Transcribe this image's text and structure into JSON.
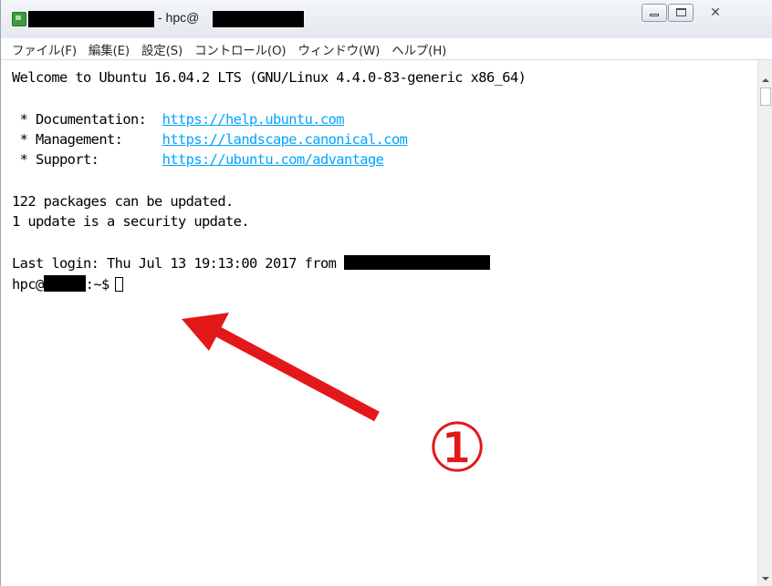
{
  "window": {
    "title_suffix": " - hpc@",
    "buttons": {
      "minimize": "minimize",
      "maximize": "maximize",
      "close": "✕"
    }
  },
  "menu": [
    "ファイル(F)",
    "編集(E)",
    "設定(S)",
    "コントロール(O)",
    "ウィンドウ(W)",
    "ヘルプ(H)"
  ],
  "terminal": {
    "welcome": "Welcome to Ubuntu 16.04.2 LTS (GNU/Linux 4.4.0-83-generic x86_64)",
    "doc_label": " * Documentation:  ",
    "doc_url": "https://help.ubuntu.com",
    "mgmt_label": " * Management:     ",
    "mgmt_url": "https://landscape.canonical.com",
    "support_label": " * Support:        ",
    "support_url": "https://ubuntu.com/advantage",
    "packages": "122 packages can be updated.",
    "security": "1 update is a security update.",
    "last_login": "Last login: Thu Jul 13 19:13:00 2017 from ",
    "prompt_user": "hpc@",
    "prompt_suffix": ":~$"
  },
  "annotation": {
    "marker": "①",
    "color": "#e3181b"
  },
  "colors": {
    "link": "#00a4ff",
    "annotation": "#e3181b"
  }
}
